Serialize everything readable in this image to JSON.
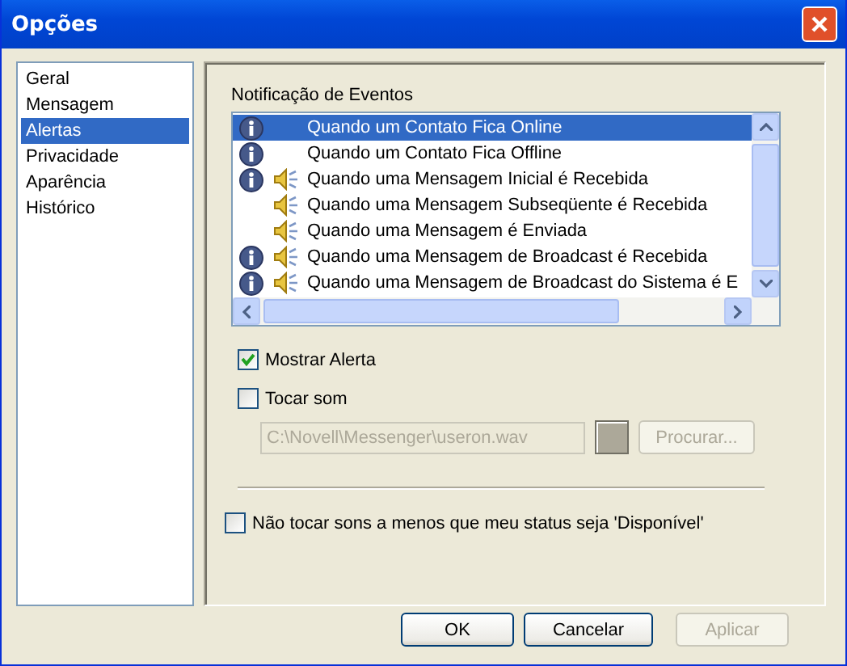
{
  "window": {
    "title": "Opções"
  },
  "sidebar": {
    "items": [
      {
        "label": "Geral",
        "selected": false
      },
      {
        "label": "Mensagem",
        "selected": false
      },
      {
        "label": "Alertas",
        "selected": true
      },
      {
        "label": "Privacidade",
        "selected": false
      },
      {
        "label": "Aparência",
        "selected": false
      },
      {
        "label": "Histórico",
        "selected": false
      }
    ]
  },
  "events": {
    "label": "Notificação de Eventos",
    "rows": [
      {
        "label": "Quando um Contato Fica Online",
        "info": true,
        "sound": false,
        "selected": true
      },
      {
        "label": "Quando um Contato Fica Offline",
        "info": true,
        "sound": false,
        "selected": false
      },
      {
        "label": "Quando uma Mensagem Inicial é Recebida",
        "info": true,
        "sound": true,
        "selected": false
      },
      {
        "label": "Quando uma Mensagem Subseqüente é Recebida",
        "info": false,
        "sound": true,
        "selected": false
      },
      {
        "label": "Quando uma Mensagem é Enviada",
        "info": false,
        "sound": true,
        "selected": false
      },
      {
        "label": "Quando uma Mensagem de Broadcast é Recebida",
        "info": true,
        "sound": true,
        "selected": false
      },
      {
        "label": "Quando uma Mensagem de Broadcast do Sistema é E",
        "info": true,
        "sound": true,
        "selected": false
      }
    ]
  },
  "show_alert": {
    "label": "Mostrar Alerta",
    "checked": true
  },
  "play_sound": {
    "label": "Tocar som",
    "checked": false
  },
  "sound_file": {
    "value": "C:\\Novell\\Messenger\\useron.wav",
    "disabled": true
  },
  "browse_button": {
    "label": "Procurar...",
    "disabled": true
  },
  "only_available": {
    "label": "Não tocar sons a menos que meu status seja 'Disponível'",
    "checked": false
  },
  "buttons": [
    {
      "label": "OK",
      "disabled": false
    },
    {
      "label": "Cancelar",
      "disabled": false
    },
    {
      "label": "Aplicar",
      "disabled": true
    }
  ]
}
